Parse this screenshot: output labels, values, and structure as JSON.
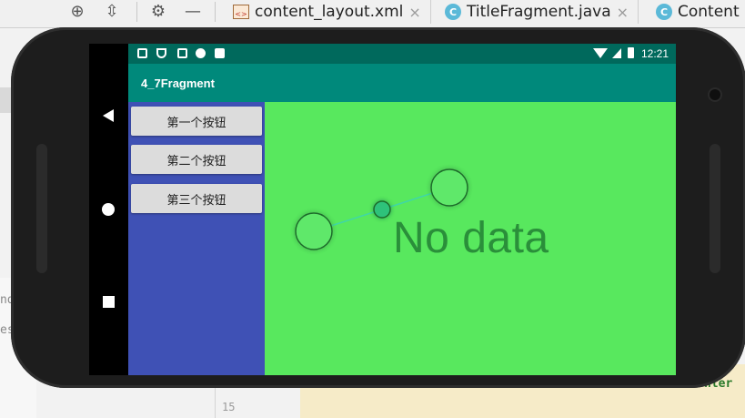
{
  "ide": {
    "tabs": [
      {
        "label": "content_layout.xml",
        "close": "×"
      },
      {
        "label": "TitleFragment.java",
        "close": "×",
        "badge": "C"
      },
      {
        "label": "Content",
        "badge": "C"
      }
    ],
    "toolbar_icons": [
      "target-icon",
      "collapse-icon",
      "gear-icon",
      "minimize-icon"
    ],
    "line_number": "15",
    "fragments": {
      "left1": "nd",
      "left2": "es",
      "right": "nter"
    }
  },
  "emulator": {
    "status_bar": {
      "time": "12:21"
    },
    "app_title": "4_7Fragment",
    "buttons": [
      "第一个按钮",
      "第二个按钮",
      "第三个按钮"
    ],
    "empty_state": "No data",
    "colors": {
      "status_bar": "#00695c",
      "app_bar": "#00897b",
      "left_panel": "#3f51b5",
      "right_panel": "#58e85e"
    }
  }
}
